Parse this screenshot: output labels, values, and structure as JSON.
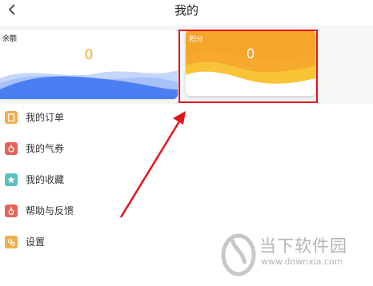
{
  "header": {
    "title": "我的",
    "back_icon": "chevron-left-icon"
  },
  "cards": {
    "balance": {
      "label": "余额",
      "value": "0"
    },
    "points": {
      "label": "积分",
      "value": "0"
    }
  },
  "menu": [
    {
      "label": "我的订单",
      "icon": "clipboard-icon",
      "color": "#f0ad4e"
    },
    {
      "label": "我的气券",
      "icon": "ticket-icon",
      "color": "#e8625a"
    },
    {
      "label": "我的收藏",
      "icon": "star-icon",
      "color": "#5bc0c0"
    },
    {
      "label": "帮助与反馈",
      "icon": "help-icon",
      "color": "#e8625a"
    },
    {
      "label": "设置",
      "icon": "gear-icon",
      "color": "#f0ad4e"
    }
  ],
  "watermark": {
    "title": "当下软件园",
    "url": "www.downxia.com"
  },
  "colors": {
    "annotation": "#e8141c",
    "balance_wave": "#4a7ef2",
    "points_wave": "#f6b42f"
  }
}
